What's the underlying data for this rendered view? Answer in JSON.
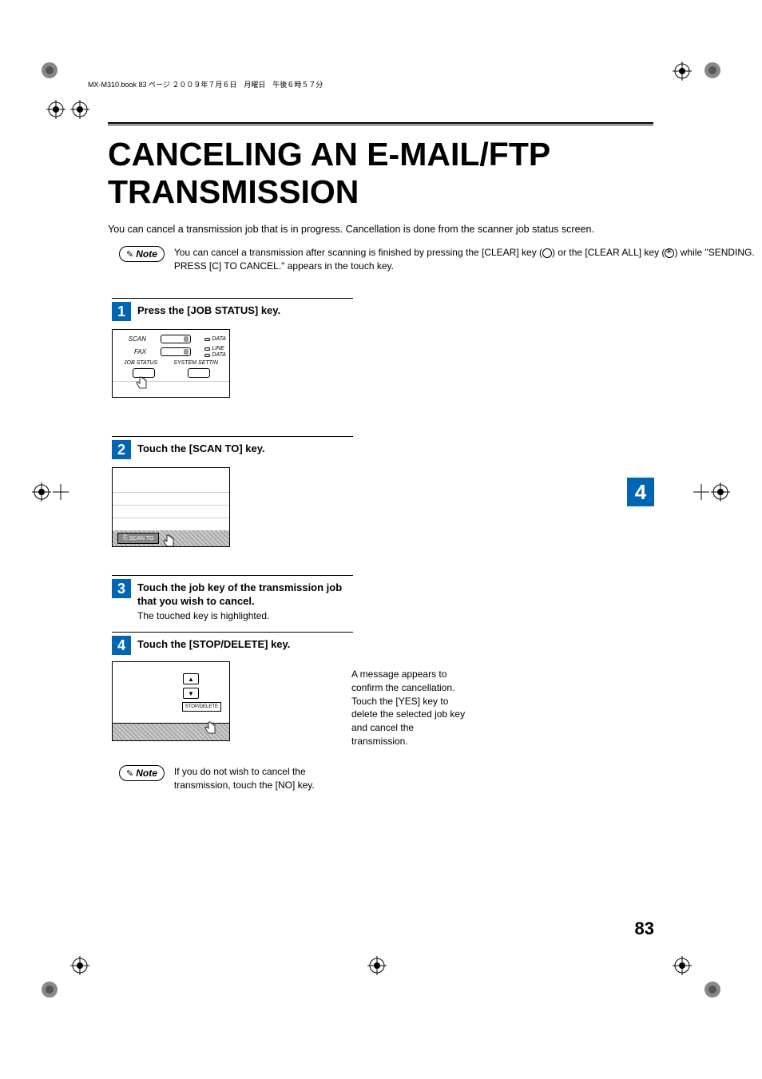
{
  "header_text": "MX-M310.book  83 ページ  ２００９年７月６日　月曜日　午後６時５７分",
  "title": "CANCELING AN E-MAIL/FTP TRANSMISSION",
  "intro": "You can cancel a transmission job that is in progress. Cancellation is done from the scanner job status screen.",
  "note_label": "Note",
  "note1": "You can cancel a transmission after scanning is finished by pressing the [CLEAR] key (",
  "note1_mid": ") or the [CLEAR ALL] key (",
  "note1_end": ") while \"SENDING. PRESS [C] TO CANCEL.\" appears in the touch key.",
  "step1": {
    "num": "1",
    "title": "Press the [JOB STATUS] key.",
    "panel": {
      "scan": "SCAN",
      "fax": "FAX",
      "data": "DATA",
      "line": "LINE",
      "job_status": "JOB STATUS",
      "system": "SYSTEM SETTIN"
    }
  },
  "step2": {
    "num": "2",
    "title": "Touch the [SCAN TO] key.",
    "button": "SCAN TO"
  },
  "step3": {
    "num": "3",
    "title": "Touch the job key of the transmission job that you wish to cancel.",
    "body": "The touched key is highlighted."
  },
  "step4": {
    "num": "4",
    "title": "Touch the [STOP/DELETE] key.",
    "button": "STOP/DELETE",
    "text": "A message appears to confirm the cancellation. Touch the [YES] key to delete the selected job key and cancel the transmission."
  },
  "note2": "If you do not wish to cancel the transmission, touch the [NO] key.",
  "side_tab": "4",
  "page_number": "83"
}
